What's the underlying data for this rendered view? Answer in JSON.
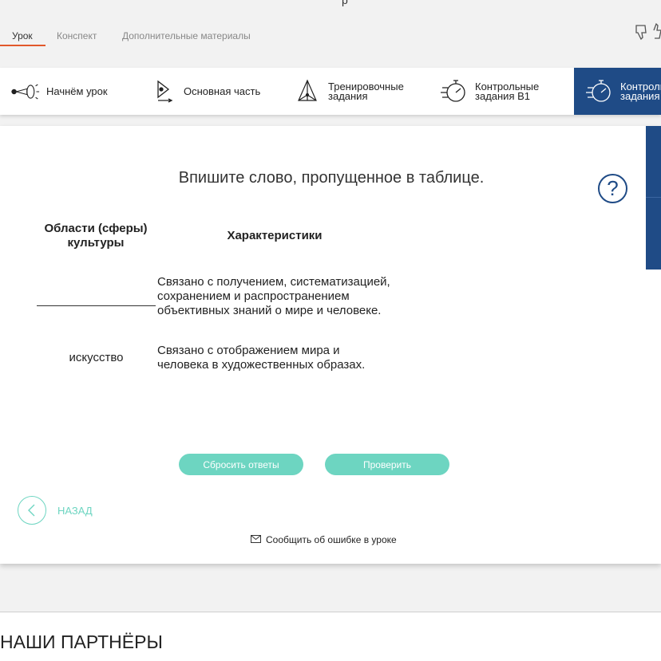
{
  "tabs": [
    "Урок",
    "Конспект",
    "Дополнительные материалы"
  ],
  "header_cut": "р",
  "nav": [
    {
      "label": "Начнём урок",
      "icon": "megaphone-icon"
    },
    {
      "label": "Основная часть",
      "icon": "play-icon"
    },
    {
      "label_1": "Тренировочные",
      "label_2": "задания",
      "icon": "pyramid-icon"
    },
    {
      "label_1": "Контрольные",
      "label_2": "задания В1",
      "icon": "stopwatch-icon"
    },
    {
      "label_1": "Контрольн",
      "label_2": "задания",
      "icon": "stopwatch-icon"
    }
  ],
  "task": {
    "question": "Впишите слово, пропущенное в таблице.",
    "help": "?",
    "col1_line1": "Области (сферы)",
    "col1_line2": "культуры",
    "col2": "Характеристики",
    "row1_l1": "Связано с получением, систематизацией,",
    "row1_l2": "сохранением и распространением",
    "row1_l3": "объективных знаний о мире и человеке.",
    "row2_term": "искусство",
    "row2_l1": "Связано с отображением мира и",
    "row2_l2": "человека в художественных образах."
  },
  "buttons": {
    "reset": "Сбросить ответы",
    "check": "Проверить"
  },
  "back_label": "НАЗАД",
  "report_label": "Сообщить об ошибке в уроке",
  "partners_title": "НАШИ ПАРТНЁРЫ",
  "colors": {
    "accent": "#6dd5c1",
    "navy": "#1f4b86",
    "tab_underline": "#e2582b"
  }
}
